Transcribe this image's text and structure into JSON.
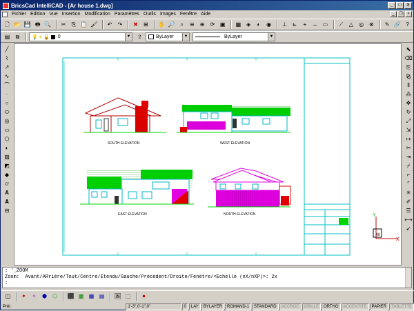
{
  "window": {
    "title": "BricsCad IntelliCAD - [Ar house 1.dwg]",
    "controls": [
      "_",
      "□",
      "×"
    ]
  },
  "menu": [
    "Fichier",
    "Edition",
    "Vue",
    "Insertion",
    "Modification",
    "Paramètres",
    "Outils",
    "Images",
    "Fenêtre",
    "Aide"
  ],
  "properties": {
    "layer": "0",
    "color": "ByLayer",
    "linetype": "ByLayer"
  },
  "drawing": {
    "views": {
      "south": "SOUTH ELEVATION",
      "west": "WEST ELEVATION",
      "east": "EAST ELEVATION",
      "north": "NORTH ELEVATION"
    },
    "ucs": {
      "x": "X",
      "y": "Y",
      "w": "W"
    }
  },
  "command": {
    "lines": [
      ": '_ZOOM",
      "Zoom:  Avant/ARrière/Tout/Centré/Etendu/Gauche/Précédent/Droite/Fenêtre/<Echelle (nX/nXP)>: 2x",
      ":"
    ]
  },
  "status": {
    "ready": "Prêt",
    "coords": "1'-3\",0'-1\",0\"",
    "layer_value": "0",
    "cells": [
      {
        "label": "LAY",
        "active": true
      },
      {
        "label": "BYLAYER",
        "active": true
      },
      {
        "label": "ROMAND-1",
        "active": true
      },
      {
        "label": "STANDARD",
        "active": true
      },
      {
        "label": "ACCROC",
        "active": false
      },
      {
        "label": "GRILLE",
        "active": false
      },
      {
        "label": "ORTHO",
        "active": true
      },
      {
        "label": "ACCENTITE",
        "active": false
      },
      {
        "label": "PAPIER",
        "active": true
      },
      {
        "label": "TABLETTE",
        "active": false
      }
    ]
  },
  "colors": {
    "roof": "#00d400",
    "wall_red": "#e00000",
    "magenta": "#e000e0",
    "cyan": "#00b4c8",
    "frame": "#00c0c0"
  }
}
